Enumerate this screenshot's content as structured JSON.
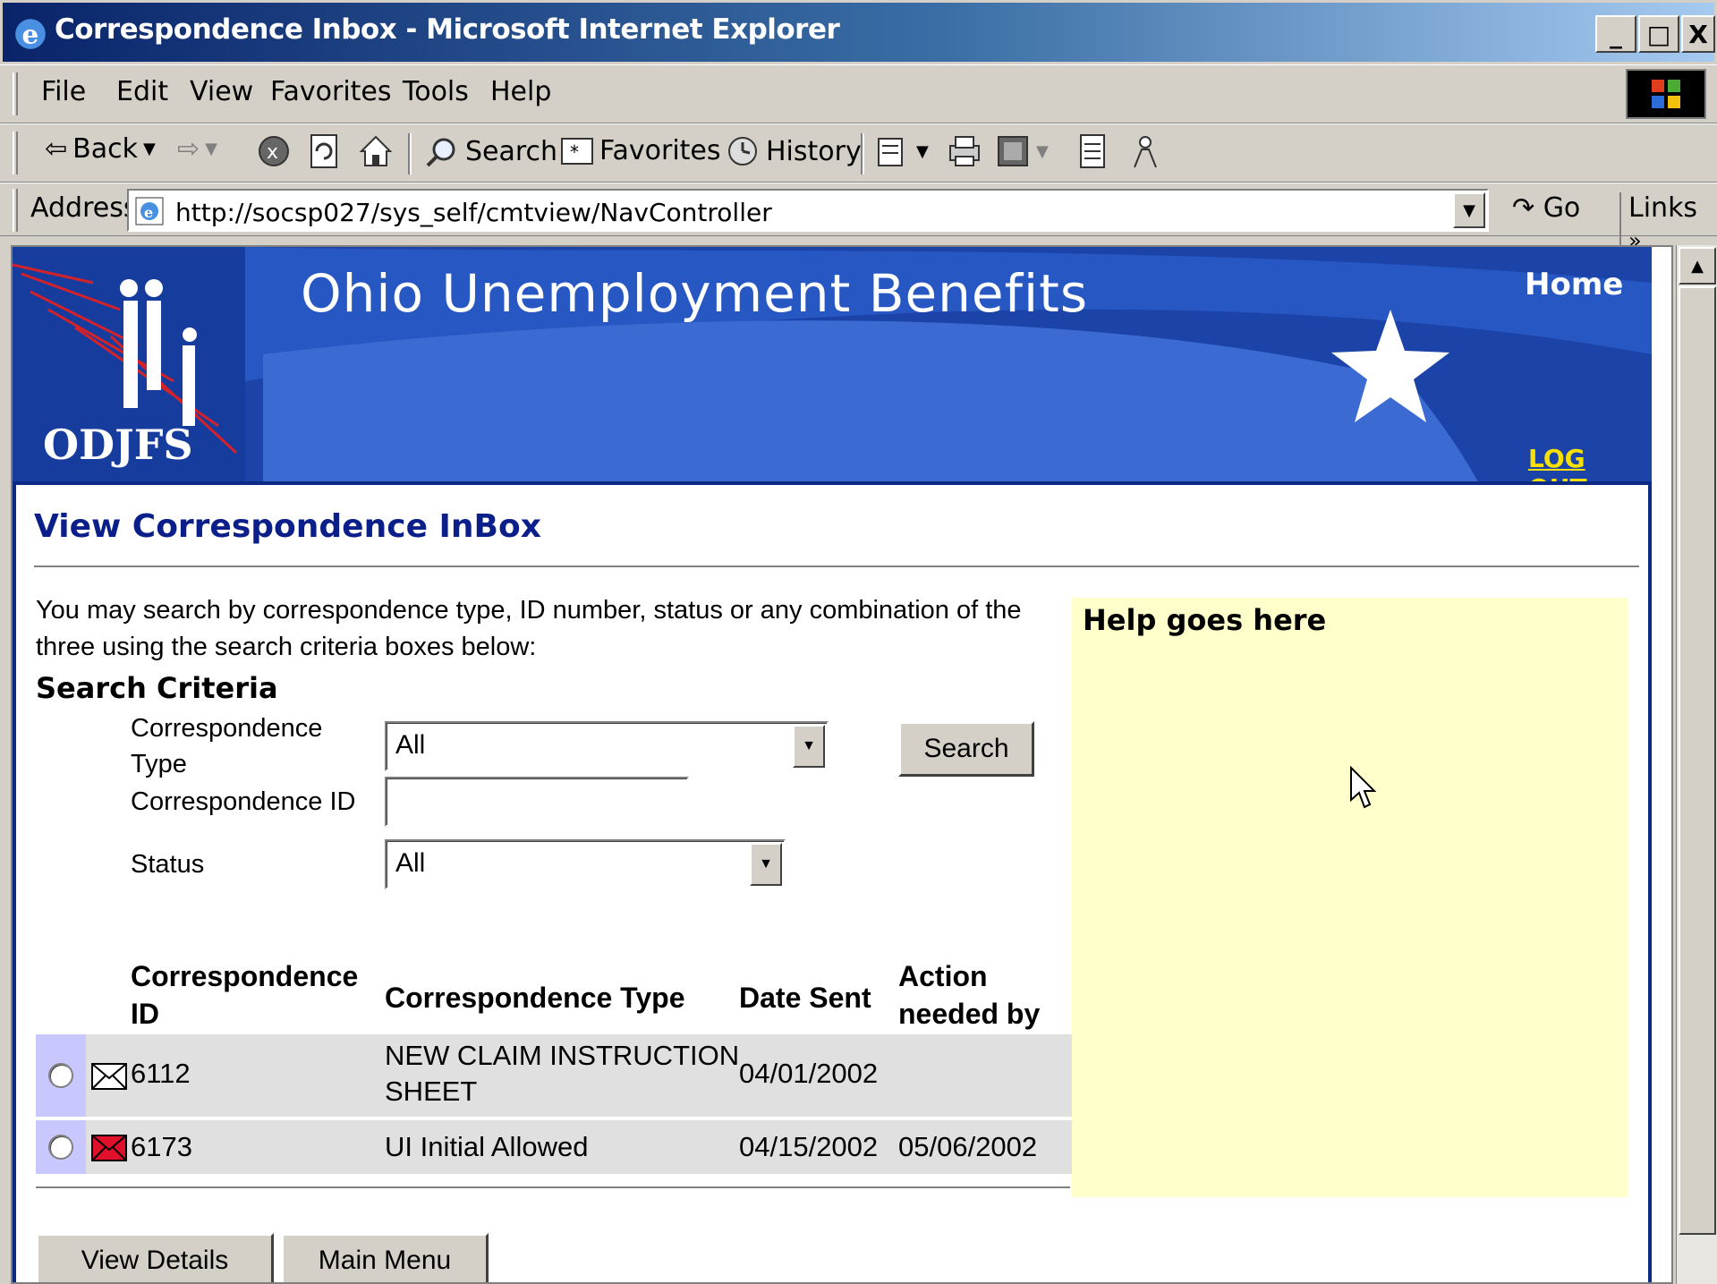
{
  "window": {
    "title": "Correspondence Inbox - Microsoft Internet Explorer",
    "controls": [
      "_",
      "□",
      "X"
    ]
  },
  "menu": [
    "File",
    "Edit",
    "View",
    "Favorites",
    "Tools",
    "Help"
  ],
  "toolbar": {
    "back": "Back",
    "search": "Search",
    "favorites": "Favorites",
    "history": "History"
  },
  "address": {
    "label": "Address",
    "url": "http://socsp027/sys_self/cmtview/NavController",
    "go": "Go",
    "links": "Links"
  },
  "banner": {
    "title": "Ohio Unemployment Benefits",
    "logo": "ODJFS",
    "home": "Home",
    "logout": "LOG OUT"
  },
  "page": {
    "heading": "View Correspondence InBox",
    "intro": "You may search by correspondence type, ID number, status or any combination of the three using the search criteria boxes below:",
    "criteria_title": "Search Criteria",
    "help": "Help goes here"
  },
  "form": {
    "type_label_1": "Correspondence",
    "type_label_2": "Type",
    "type_value": "All",
    "id_label": "Correspondence ID",
    "id_value": "",
    "status_label": "Status",
    "status_value": "All",
    "search_button": "Search"
  },
  "table": {
    "headers": {
      "id_1": "Correspondence",
      "id_2": "ID",
      "type": "Correspondence Type",
      "date": "Date Sent",
      "action_1": "Action",
      "action_2": "needed by"
    },
    "rows": [
      {
        "id": "6112",
        "type_1": "NEW CLAIM INSTRUCTION",
        "type_2": "SHEET",
        "date": "04/01/2002",
        "action": "",
        "icon": "envelope-read-icon"
      },
      {
        "id": "6173",
        "type_1": "UI Initial Allowed",
        "type_2": "",
        "date": "04/15/2002",
        "action": "05/06/2002",
        "icon": "envelope-unread-icon"
      }
    ]
  },
  "buttons": {
    "view_details": "View Details",
    "main_menu": "Main Menu"
  },
  "colors": {
    "banner_blue": "#1b43a8",
    "heading_blue": "#0b1f8a",
    "help_bg": "#ffffcc",
    "logout_yellow": "#f8e000"
  }
}
